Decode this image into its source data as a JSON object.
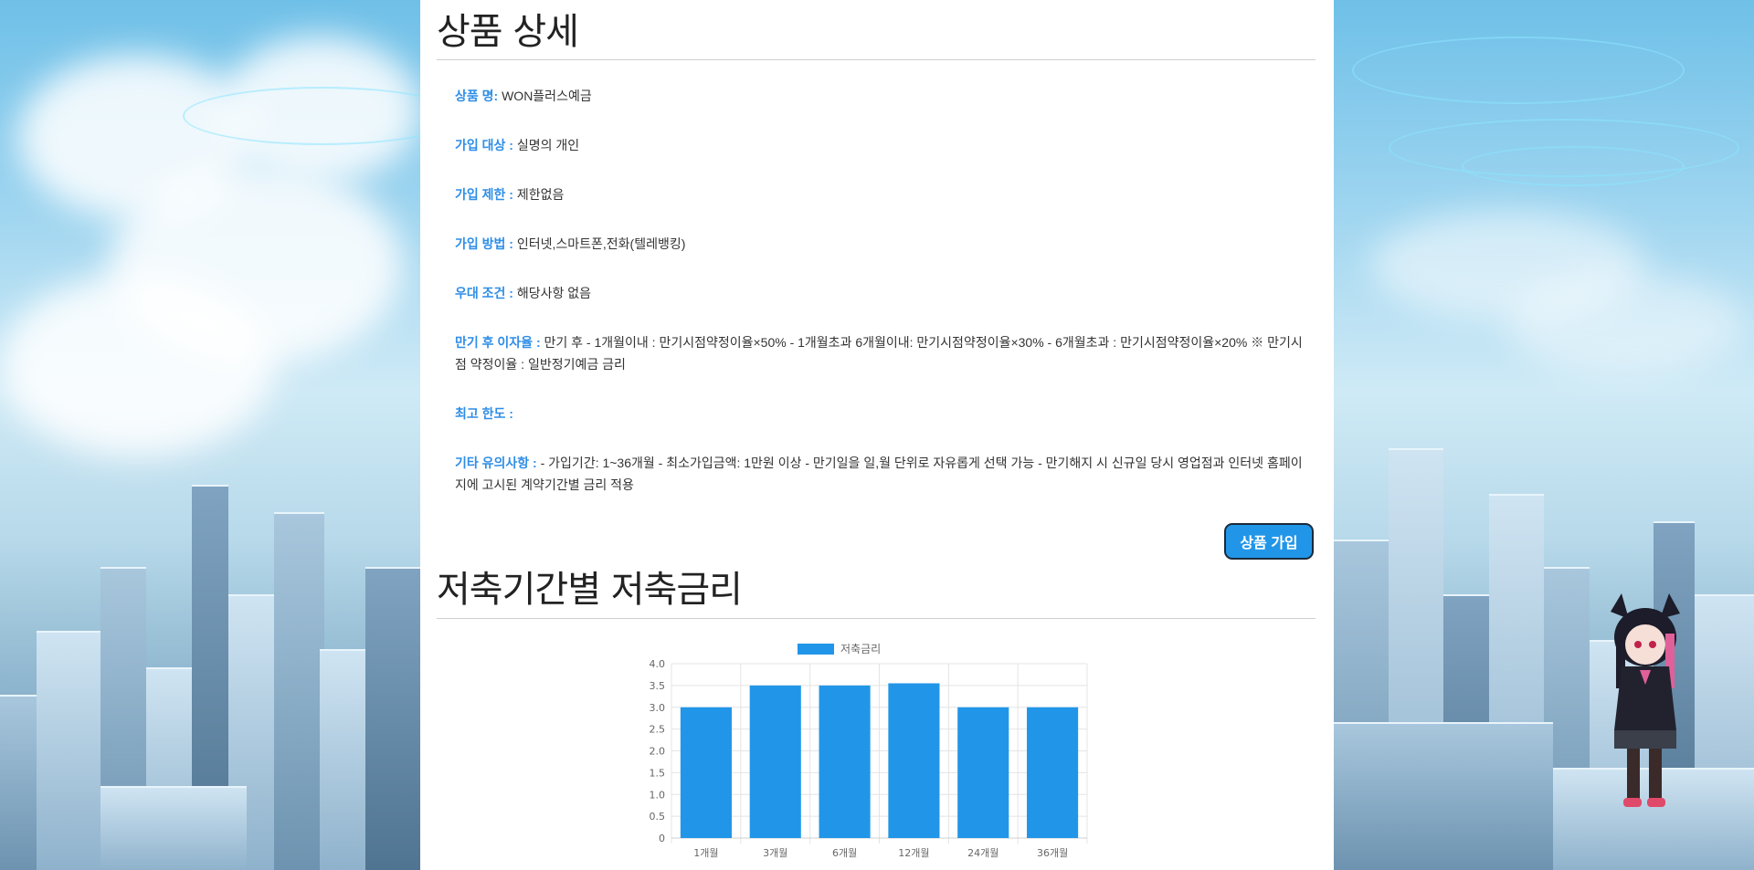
{
  "colors": {
    "label": "#2f8ee6",
    "bar": "#2196e8",
    "button_bg": "#2196e8",
    "button_text": "#ffffff"
  },
  "detail": {
    "title": "상품 상세",
    "rows": [
      {
        "label": "상품 명:",
        "value": " WON플러스예금"
      },
      {
        "label": "가입 대상 :",
        "value": " 실명의 개인"
      },
      {
        "label": "가입 제한 :",
        "value": " 제한없음"
      },
      {
        "label": "가입 방법 :",
        "value": " 인터넷,스마트폰,전화(텔레뱅킹)"
      },
      {
        "label": "우대 조건 :",
        "value": " 해당사항 없음"
      },
      {
        "label": "만기 후 이자율 :",
        "value": " 만기 후 - 1개월이내 : 만기시점약정이율×50% - 1개월초과 6개월이내: 만기시점약정이율×30% - 6개월초과 : 만기시점약정이율×20% ※ 만기시점 약정이율 : 일반정기예금 금리"
      },
      {
        "label": "최고 한도 :",
        "value": ""
      },
      {
        "label": "기타 유의사항 :",
        "value": " - 가입기간: 1~36개월 - 최소가입금액: 1만원 이상 - 만기일을 일,월 단위로 자유롭게 선택 가능 - 만기해지 시 신규일 당시 영업점과 인터넷 홈페이지에 고시된 계약기간별 금리 적용"
      }
    ],
    "join_button": "상품 가입"
  },
  "rates": {
    "title": "저축기간별 저축금리"
  },
  "chart_data": {
    "type": "bar",
    "categories": [
      "1개월",
      "3개월",
      "6개월",
      "12개월",
      "24개월",
      "36개월"
    ],
    "series": [
      {
        "name": "저축금리",
        "values": [
          3.0,
          3.5,
          3.5,
          3.55,
          3.0,
          3.0
        ]
      }
    ],
    "ylim": [
      0,
      4.0
    ],
    "yticks": [
      "0",
      "0.5",
      "1.0",
      "1.5",
      "2.0",
      "2.5",
      "3.0",
      "3.5",
      "4.0"
    ],
    "legend_position": "top",
    "grid": true
  },
  "background": {
    "mascot_icon": "cat-girl-mascot-icon"
  }
}
